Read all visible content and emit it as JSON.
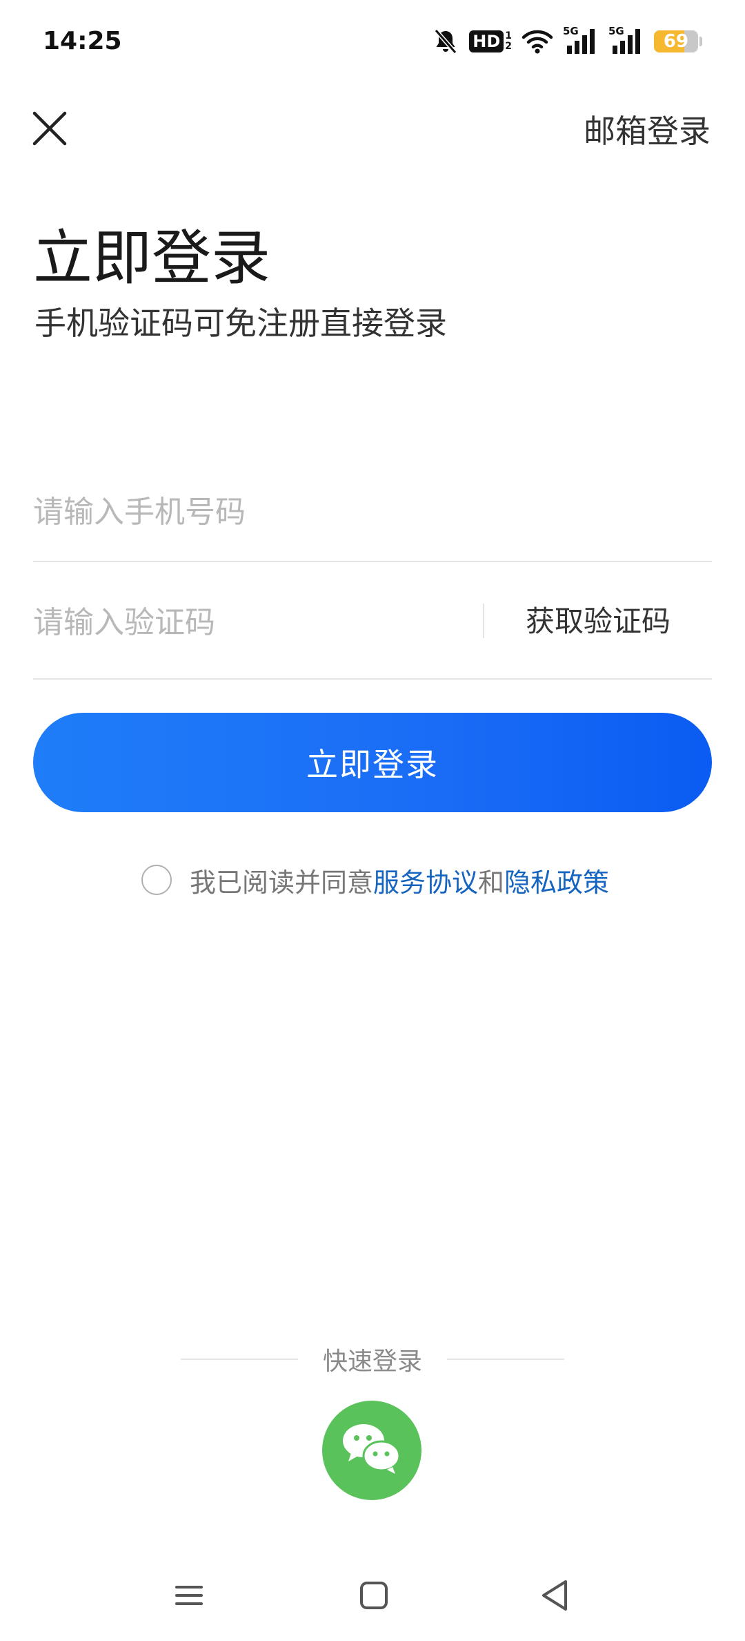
{
  "status_bar": {
    "time": "14:25",
    "hd_label": "HD",
    "hd_sub_top": "1",
    "hd_sub_bottom": "2",
    "sim1_label": "5G",
    "sim2_label": "5G",
    "battery_level": "69",
    "battery_fraction": 0.69,
    "battery_color": "#f5b82e"
  },
  "top_bar": {
    "email_login_label": "邮箱登录"
  },
  "header": {
    "title": "立即登录",
    "subtitle": "手机验证码可免注册直接登录"
  },
  "form": {
    "phone_placeholder": "请输入手机号码",
    "phone_value": "",
    "code_placeholder": "请输入验证码",
    "code_value": "",
    "get_code_label": "获取验证码",
    "submit_label": "立即登录",
    "primary_color": "#1a6cf6"
  },
  "agreement": {
    "checked": false,
    "prefix": "我已阅读并同意",
    "service_link": "服务协议",
    "conjunction": "和",
    "privacy_link": "隐私政策",
    "link_color": "#1565c0"
  },
  "quick_login": {
    "label": "快速登录",
    "wechat_icon": "wechat-icon",
    "wechat_color": "#5ac25a"
  },
  "nav_bar": {
    "menu_icon": "menu-icon",
    "home_icon": "home-icon",
    "back_icon": "back-icon"
  }
}
